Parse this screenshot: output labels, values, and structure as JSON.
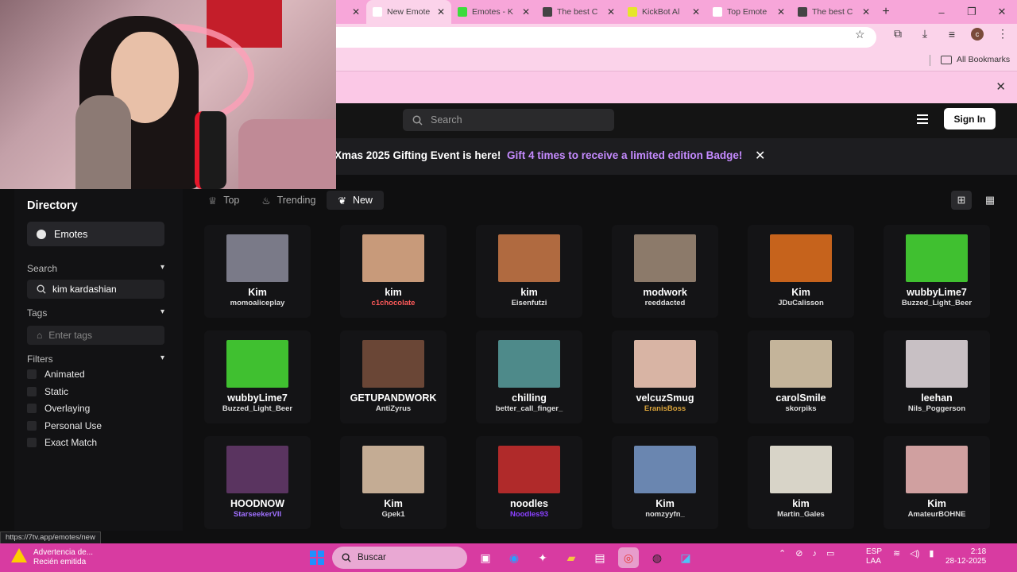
{
  "browser": {
    "tabs": [
      {
        "title": "",
        "color": "#f7a6d9"
      },
      {
        "title": "New Emote",
        "color": "#ffffff",
        "active": true
      },
      {
        "title": "Emotes - K",
        "color": "#3ddc3d"
      },
      {
        "title": "The best C",
        "color": "#444444"
      },
      {
        "title": "KickBot Al",
        "color": "#e6e62a"
      },
      {
        "title": "Top Emote",
        "color": "#ffffff"
      },
      {
        "title": "The best C",
        "color": "#444444"
      }
    ],
    "profile_initial": "c",
    "all_bookmarks": "All Bookmarks"
  },
  "header": {
    "search_placeholder": "Search",
    "signin_label": "Sign In"
  },
  "banner": {
    "event_text": "Xmas 2025 Gifting Event is here!",
    "link_text": "Gift 4 times to receive a limited edition Badge!"
  },
  "sidebar": {
    "title": "Directory",
    "emotes_label": "Emotes",
    "search_heading": "Search",
    "search_value": "kim kardashian",
    "tags_heading": "Tags",
    "tags_placeholder": "Enter tags",
    "filters_heading": "Filters",
    "filters": [
      "Animated",
      "Static",
      "Overlaying",
      "Personal Use",
      "Exact Match"
    ]
  },
  "sort_tabs": {
    "top": "Top",
    "trending": "Trending",
    "new": "New"
  },
  "emotes": [
    {
      "name": "Kim",
      "author": "momoaliceplay",
      "author_color": "#dddddd",
      "thumb": "#7a7a88"
    },
    {
      "name": "kim",
      "author": "c1chocolate",
      "author_color": "#ff5a5a",
      "thumb": "#c89a7a"
    },
    {
      "name": "kim",
      "author": "Eisenfutzi",
      "author_color": "#dddddd",
      "thumb": "#b06a40"
    },
    {
      "name": "modwork",
      "author": "reeddacted",
      "author_color": "#dddddd",
      "thumb": "#8c7a6a"
    },
    {
      "name": "Kim",
      "author": "JDuCalisson",
      "author_color": "#dddddd",
      "thumb": "#c6631c"
    },
    {
      "name": "wubbyLime7",
      "author": "Buzzed_Light_Beer",
      "author_color": "#dddddd",
      "thumb": "#40c030"
    },
    {
      "name": "wubbyLime7",
      "author": "Buzzed_Light_Beer",
      "author_color": "#dddddd",
      "thumb": "#40c030"
    },
    {
      "name": "GETUPANDWORK",
      "author": "AntiZyrus",
      "author_color": "#dddddd",
      "thumb": "#6a4636"
    },
    {
      "name": "chilling",
      "author": "better_call_finger_",
      "author_color": "#dddddd",
      "thumb": "#4e8a8a"
    },
    {
      "name": "velcuzSmug",
      "author": "EranisBoss",
      "author_color": "#d9a33a",
      "thumb": "#d8b4a4"
    },
    {
      "name": "carolSmile",
      "author": "skorpiks",
      "author_color": "#dddddd",
      "thumb": "#c4b49a"
    },
    {
      "name": "leehan",
      "author": "Nils_Poggerson",
      "author_color": "#dddddd",
      "thumb": "#c8c0c4"
    },
    {
      "name": "HOODNOW",
      "author": "StarseekerVII",
      "author_color": "#a070ff",
      "thumb": "#5a3460"
    },
    {
      "name": "Kim",
      "author": "Gpek1",
      "author_color": "#dddddd",
      "thumb": "#c4ac94"
    },
    {
      "name": "noodles",
      "author": "Noodles93",
      "author_color": "#8a40ff",
      "thumb": "#b02a2a"
    },
    {
      "name": "Kim",
      "author": "nomzyyfn_",
      "author_color": "#dddddd",
      "thumb": "#6a86b0"
    },
    {
      "name": "kim",
      "author": "Martin_Gales",
      "author_color": "#dddddd",
      "thumb": "#d8d4c8"
    },
    {
      "name": "Kim",
      "author": "AmateurBOHNE",
      "author_color": "#dddddd",
      "thumb": "#d0a0a0"
    }
  ],
  "status_url": "https://7tv.app/emotes/new",
  "taskbar": {
    "notification_title": "Advertencia de...",
    "notification_sub": "Recién emitida",
    "search_label": "Buscar",
    "lang_1": "ESP",
    "lang_2": "LAA",
    "time": "2:18",
    "date": "28-12-2025"
  }
}
